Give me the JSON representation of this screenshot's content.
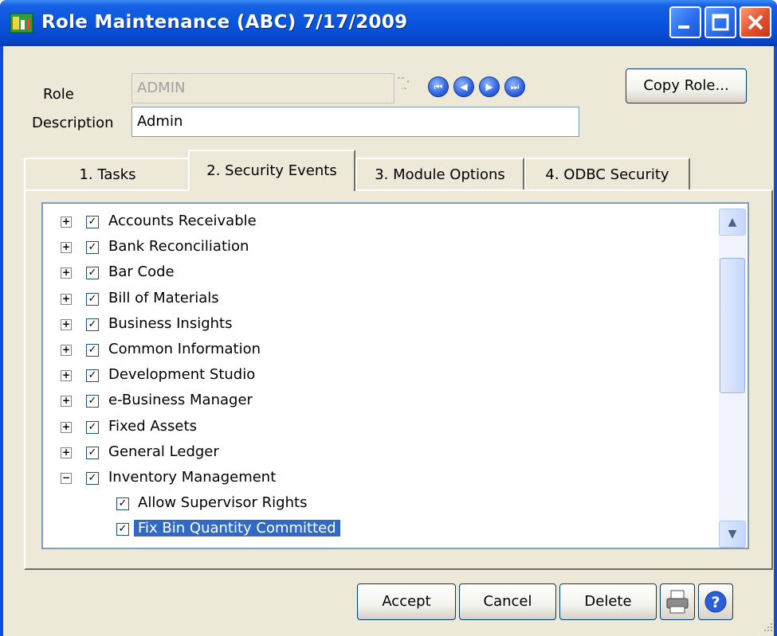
{
  "window": {
    "title": "Role Maintenance (ABC) 7/17/2009"
  },
  "form": {
    "role_label": "Role",
    "role_value": "ADMIN",
    "description_label": "Description",
    "description_value": "Admin",
    "copy_role_label": "Copy Role..."
  },
  "tabs": [
    {
      "label": "1. Tasks",
      "active": false
    },
    {
      "label": "2. Security Events",
      "active": true
    },
    {
      "label": "3. Module Options",
      "active": false
    },
    {
      "label": "4. ODBC Security",
      "active": false
    }
  ],
  "tree": {
    "items": [
      {
        "label": "Accounts Receivable",
        "expanded": false,
        "checked": true
      },
      {
        "label": "Bank Reconciliation",
        "expanded": false,
        "checked": true
      },
      {
        "label": "Bar Code",
        "expanded": false,
        "checked": true
      },
      {
        "label": "Bill of Materials",
        "expanded": false,
        "checked": true
      },
      {
        "label": "Business Insights",
        "expanded": false,
        "checked": true
      },
      {
        "label": "Common Information",
        "expanded": false,
        "checked": true
      },
      {
        "label": "Development Studio",
        "expanded": false,
        "checked": true
      },
      {
        "label": "e-Business Manager",
        "expanded": false,
        "checked": true
      },
      {
        "label": "Fixed Assets",
        "expanded": false,
        "checked": true
      },
      {
        "label": "General Ledger",
        "expanded": false,
        "checked": true
      },
      {
        "label": "Inventory Management",
        "expanded": true,
        "checked": true
      }
    ],
    "children": [
      {
        "label": "Allow Supervisor Rights",
        "checked": true,
        "selected": false
      },
      {
        "label": "Fix Bin Quantity Committed",
        "checked": true,
        "selected": true
      }
    ]
  },
  "buttons": {
    "accept": "Accept",
    "cancel": "Cancel",
    "delete": "Delete"
  },
  "colors": {
    "titlebar": "#0a55dd",
    "selection": "#316ac5",
    "face": "#ece9d8"
  }
}
